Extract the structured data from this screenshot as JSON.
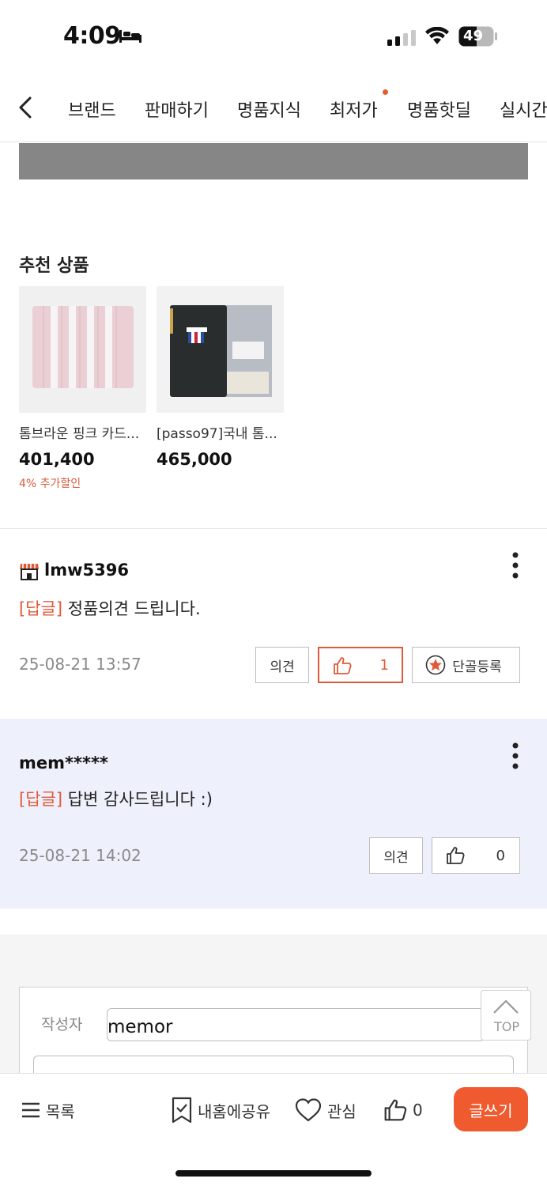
{
  "status_bar": {
    "time": "4:09",
    "battery": "49"
  },
  "nav": {
    "tabs": [
      "브랜드",
      "판매하기",
      "명품지식",
      "최저가",
      "명품핫딜",
      "실시간"
    ]
  },
  "recommended": {
    "title": "추천 상품",
    "products": [
      {
        "name": "톰브라운 핑크 카드...",
        "price": "401,400",
        "discount": "4% 추가할인"
      },
      {
        "name": "[passo97]국내 톰...",
        "price": "465,000"
      }
    ]
  },
  "comments": [
    {
      "author": "lmw5396",
      "tag": "[답글]",
      "text": " 정품의견 드립니다.",
      "date": "25-08-21 13:57",
      "opinion_label": "의견",
      "like_count": "1",
      "regular_label": "단골등록"
    },
    {
      "author": "mem*****",
      "tag": "[답글]",
      "text": " 답변 감사드립니다 :)",
      "date": "25-08-21 14:02",
      "opinion_label": "의견",
      "like_count": "0"
    }
  ],
  "form": {
    "author_label": "작성자",
    "author_value": "memor"
  },
  "top_button": "TOP",
  "bottom_bar": {
    "list_label": "목록",
    "share_label": "내홈에공유",
    "interest_label": "관심",
    "like_count": "0",
    "write_label": "글쓰기"
  },
  "colors": {
    "accent": "#ef5a2e",
    "reply_bg": "#eef0fb"
  }
}
